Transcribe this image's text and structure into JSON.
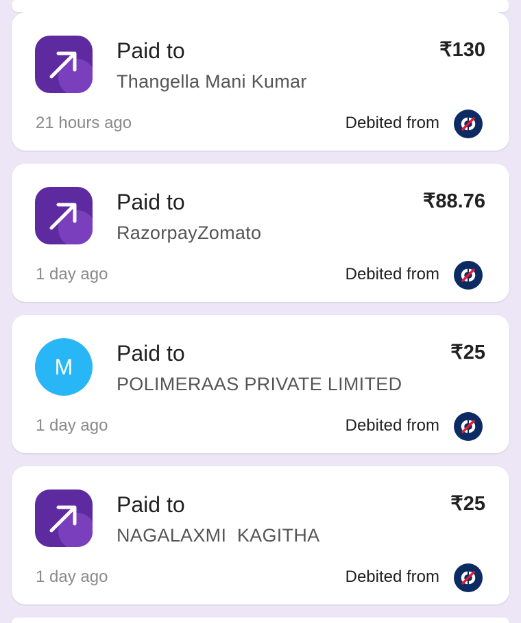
{
  "transactions": [
    {
      "title": "Paid to",
      "payee": "Thangella Mani Kumar",
      "amount": "₹130",
      "time": "21 hours ago",
      "debit_label": "Debited from",
      "icon": "arrow-up-right-icon"
    },
    {
      "title": "Paid to",
      "payee": "RazorpayZomato",
      "amount": "₹88.76",
      "time": "1 day ago",
      "debit_label": "Debited from",
      "icon": "arrow-up-right-icon"
    },
    {
      "title": "Paid to",
      "payee": "POLIMERAAS PRIVATE LIMITED",
      "amount": "₹25",
      "time": "1 day ago",
      "debit_label": "Debited from",
      "icon": "letter-avatar",
      "initial": "M"
    },
    {
      "title": "Paid to",
      "payee": "NAGALAXMI  KAGITHA",
      "amount": "₹25",
      "time": "1 day ago",
      "debit_label": "Debited from",
      "icon": "arrow-up-right-icon"
    }
  ],
  "colors": {
    "background": "#ece6f6",
    "avatar_purple": "#5e2a9f",
    "avatar_blue": "#29b6f6",
    "bank_navy": "#0d2b63",
    "bank_red": "#e8192c"
  }
}
